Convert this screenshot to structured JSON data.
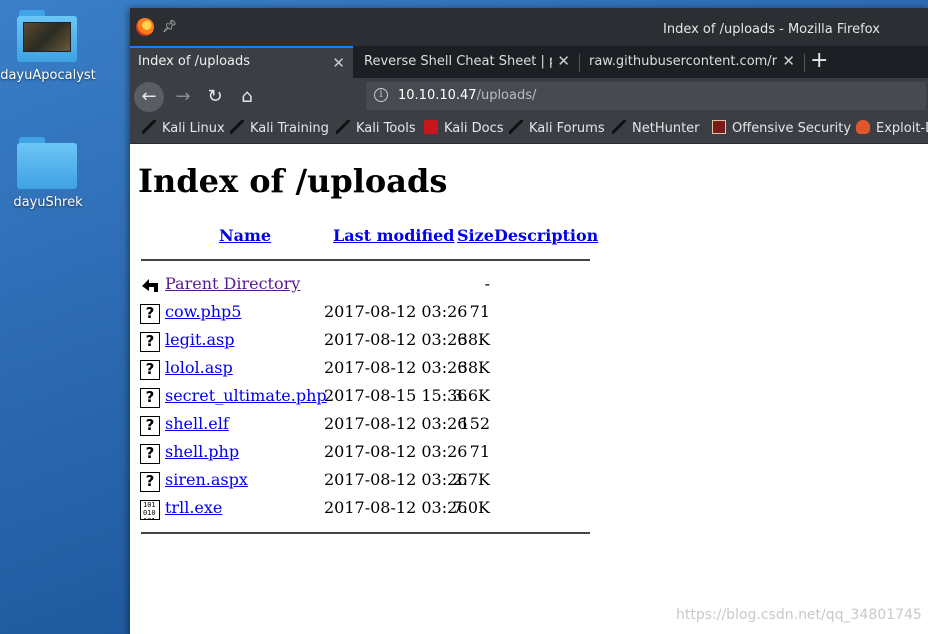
{
  "desktop": {
    "icons": [
      {
        "label": "dayuApocalyst"
      },
      {
        "label": "dayuShrek"
      }
    ]
  },
  "window": {
    "title": "Index of /uploads - Mozilla Firefox"
  },
  "tabs": [
    {
      "label": "Index of /uploads",
      "active": true
    },
    {
      "label": "Reverse Shell Cheat Sheet | pe",
      "active": false
    },
    {
      "label": "raw.githubusercontent.com/rc",
      "active": false
    }
  ],
  "url": {
    "host": "10.10.10.47",
    "path": "/uploads/"
  },
  "bookmarks": [
    {
      "label": "Kali Linux",
      "icon": "kali-icon"
    },
    {
      "label": "Kali Training",
      "icon": "kali-icon"
    },
    {
      "label": "Kali Tools",
      "icon": "kali-icon"
    },
    {
      "label": "Kali Docs",
      "icon": "docs-icon"
    },
    {
      "label": "Kali Forums",
      "icon": "kali-icon"
    },
    {
      "label": "NetHunter",
      "icon": "kali-icon"
    },
    {
      "label": "Offensive Security",
      "icon": "offsec-icon"
    },
    {
      "label": "Exploit-D",
      "icon": "exploit-db-icon"
    }
  ],
  "page": {
    "heading": "Index of /uploads",
    "columns": {
      "name": "Name",
      "last_modified": "Last modified",
      "size": "Size",
      "description": "Description"
    },
    "parent": {
      "name": "Parent Directory",
      "size": "-"
    },
    "files": [
      {
        "name": "cow.php5",
        "date": "2017-08-12 03:26",
        "size": "71",
        "icon": "unknown-file-icon"
      },
      {
        "name": "legit.asp",
        "date": "2017-08-12 03:26",
        "size": "38K",
        "icon": "unknown-file-icon"
      },
      {
        "name": "lolol.asp",
        "date": "2017-08-12 03:26",
        "size": "38K",
        "icon": "unknown-file-icon"
      },
      {
        "name": "secret_ultimate.php",
        "date": "2017-08-15 15:36",
        "size": "3.6K",
        "icon": "unknown-file-icon"
      },
      {
        "name": "shell.elf",
        "date": "2017-08-12 03:26",
        "size": "152",
        "icon": "unknown-file-icon"
      },
      {
        "name": "shell.php",
        "date": "2017-08-12 03:26",
        "size": "71",
        "icon": "unknown-file-icon"
      },
      {
        "name": "siren.aspx",
        "date": "2017-08-12 03:26",
        "size": "2.7K",
        "icon": "unknown-file-icon"
      },
      {
        "name": "trll.exe",
        "date": "2017-08-12 03:26",
        "size": "7.0K",
        "icon": "binary-file-icon"
      }
    ]
  },
  "watermark": "https://blog.csdn.net/qq_34801745"
}
